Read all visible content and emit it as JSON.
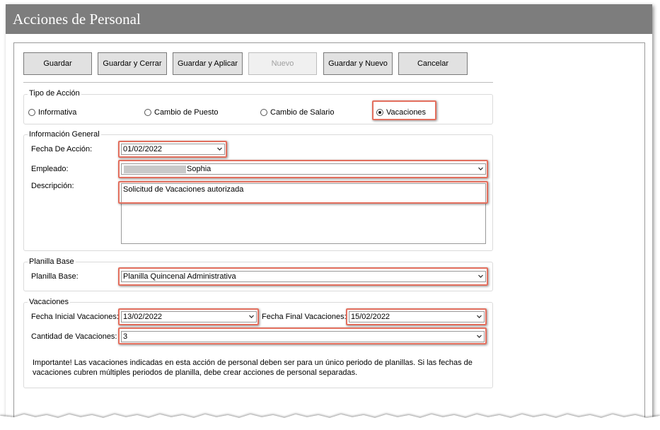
{
  "window": {
    "title": "Acciones de Personal"
  },
  "toolbar": {
    "guardar": "Guardar",
    "guardar_cerrar": "Guardar y Cerrar",
    "guardar_aplicar": "Guardar y Aplicar",
    "nuevo": "Nuevo",
    "guardar_nuevo": "Guardar y Nuevo",
    "cancelar": "Cancelar"
  },
  "tipo_accion": {
    "group_label": "Tipo de Acción",
    "options": [
      "Informativa",
      "Cambio de Puesto",
      "Cambio de Salario",
      "Vacaciones"
    ],
    "selected": "Vacaciones"
  },
  "info_general": {
    "group_label": "Información General",
    "fecha_label": "Fecha De Acción:",
    "fecha_value": "01/02/2022",
    "empleado_label": "Empleado:",
    "empleado_value": "Sophia",
    "descripcion_label": "Descripción:",
    "descripcion_value": "Solicitud de Vacaciones autorizada"
  },
  "planilla": {
    "group_label": "Planilla Base",
    "label": "Planilla Base:",
    "value": "Planilla Quincenal Administrativa"
  },
  "vacaciones": {
    "group_label": "Vacaciones",
    "fecha_inicial_label": "Fecha Inicial Vacaciones:",
    "fecha_inicial_value": "13/02/2022",
    "fecha_final_label": "Fecha Final Vacaciones:",
    "fecha_final_value": "15/02/2022",
    "cantidad_label": "Cantidad de Vacaciones:",
    "cantidad_value": "3",
    "note_line1": "Importante! Las vacaciones indicadas en esta acción de personal deben ser para un único periodo de planillas. Si las fechas de",
    "note_line2": "vacaciones cubren múltiples periodos de planilla, debe crear acciones de personal separadas."
  },
  "colors": {
    "title_bg": "#7d7d7d",
    "highlight": "#e36f5e"
  }
}
